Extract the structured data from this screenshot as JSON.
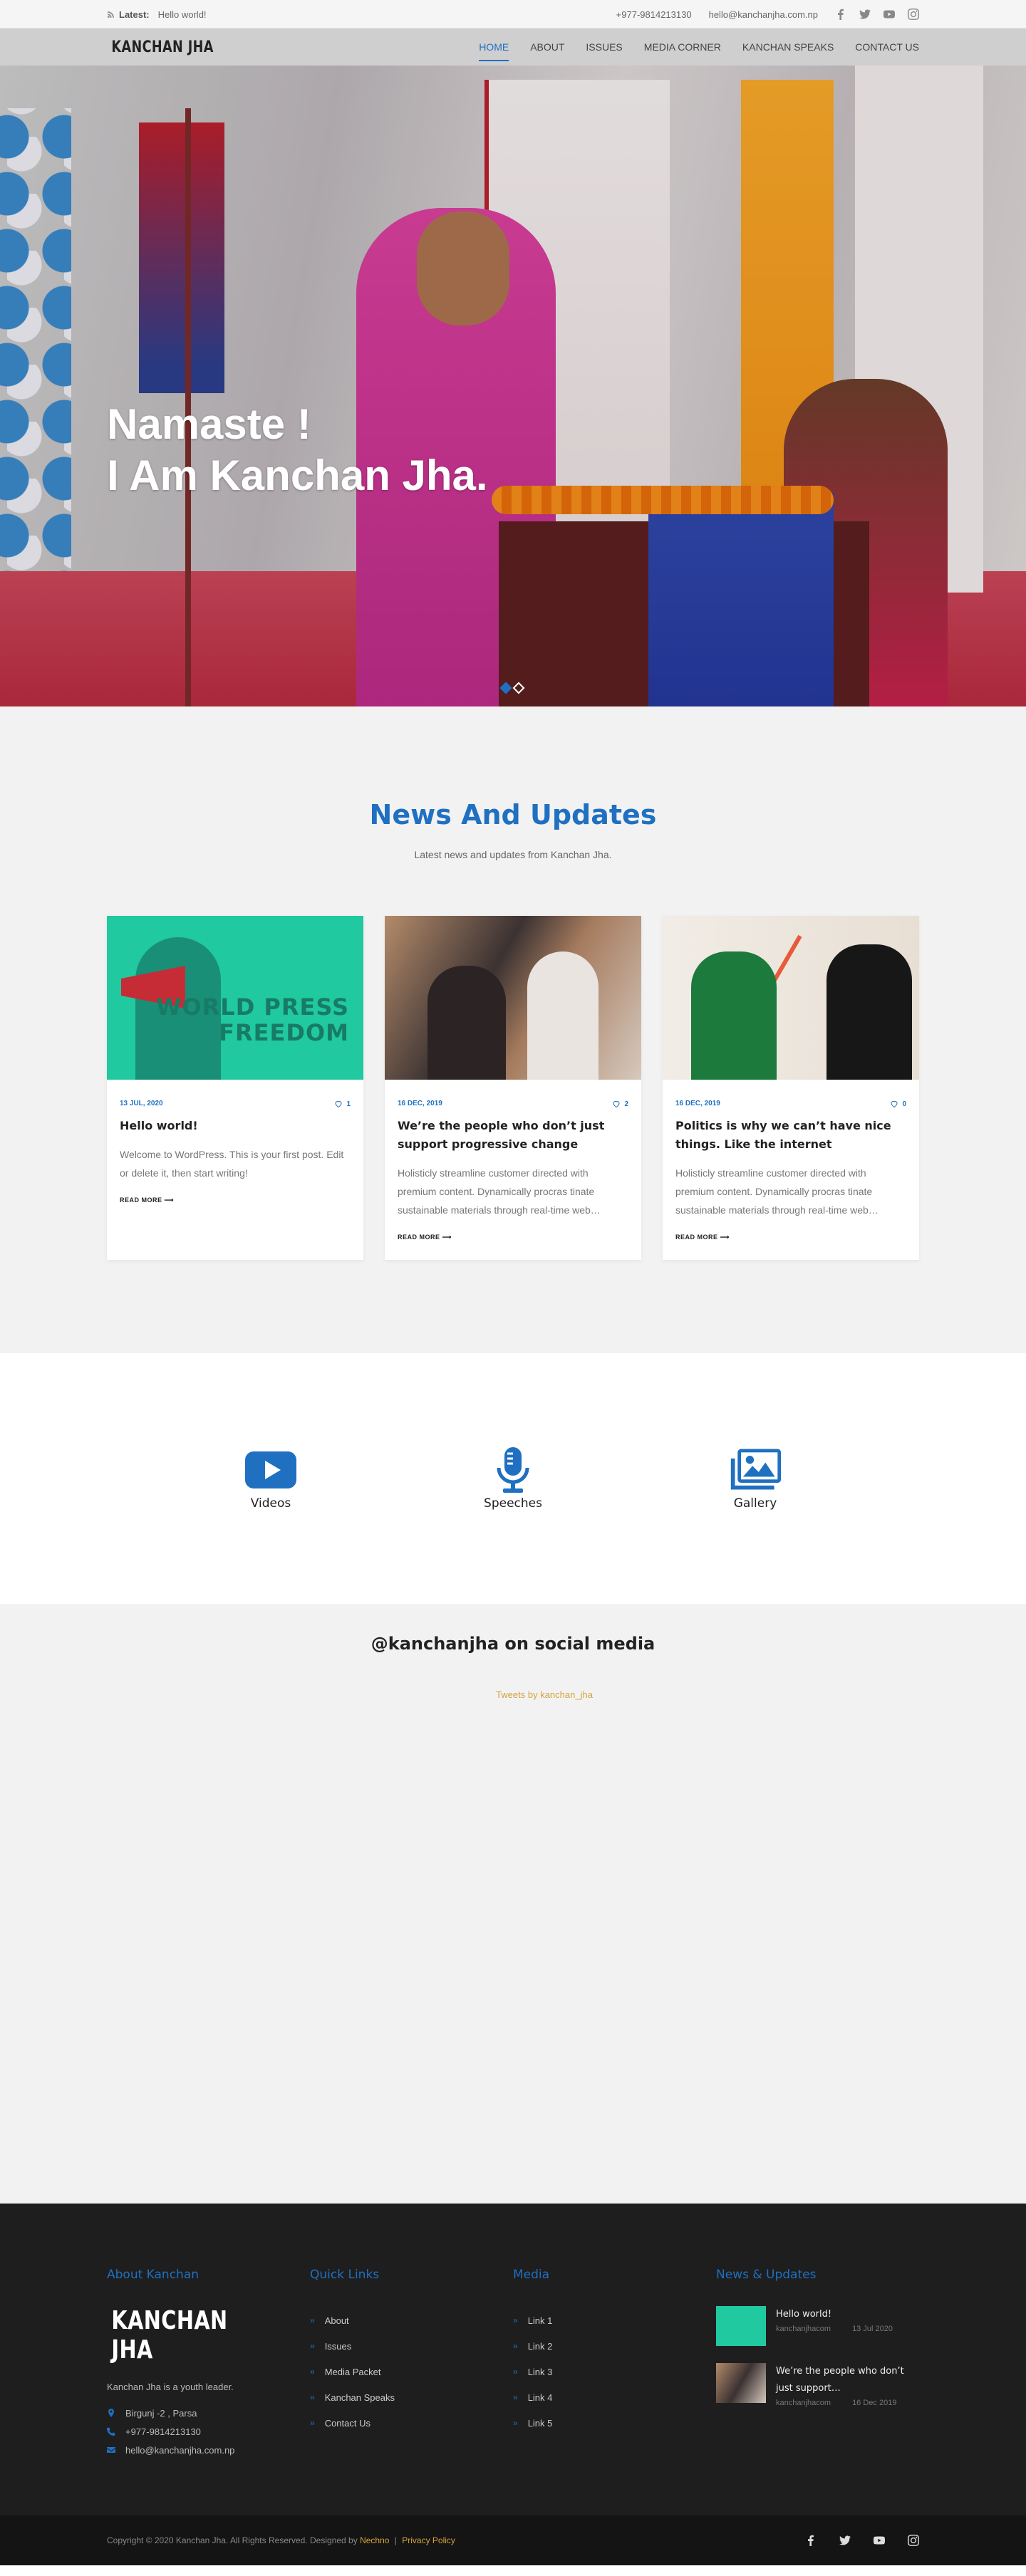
{
  "topbar": {
    "latest_label": "Latest:",
    "latest_text": "Hello world!",
    "phone": "+977-9814213130",
    "email": "hello@kanchanjha.com.np",
    "social_icons": [
      "facebook-icon",
      "twitter-icon",
      "youtube-icon",
      "instagram-icon"
    ]
  },
  "nav": {
    "logo": "KANCHAN JHA",
    "items": [
      {
        "label": "HOME",
        "active": true
      },
      {
        "label": "ABOUT"
      },
      {
        "label": "ISSUES"
      },
      {
        "label": "MEDIA CORNER"
      },
      {
        "label": "KANCHAN SPEAKS"
      },
      {
        "label": "CONTACT US"
      }
    ]
  },
  "hero": {
    "line1": "Namaste !",
    "line2": "I Am Kanchan Jha.",
    "slides": 2,
    "active_slide": 1
  },
  "news": {
    "title": "News And Updates",
    "subtitle": "Latest news and updates from Kanchan Jha.",
    "posts": [
      {
        "date": "13 JUL, 2020",
        "likes": "1",
        "title": "Hello world!",
        "excerpt": "Welcome to WordPress. This is your first post. Edit or delete it, then start writing!",
        "read_more": "READ MORE ⟶",
        "image_text": "WORLD PRESS FREEDOM"
      },
      {
        "date": "16 DEC, 2019",
        "likes": "2",
        "title": "We’re the people who don’t just support progressive change",
        "excerpt": "Holisticly streamline customer directed with premium content. Dynamically procras tinate sustainable materials through real-time web…",
        "read_more": "READ MORE ⟶"
      },
      {
        "date": "16 DEC, 2019",
        "likes": "0",
        "title": "Politics is why we can’t have nice things. Like the internet",
        "excerpt": "Holisticly streamline customer directed with premium content. Dynamically procras tinate sustainable materials through real-time web…",
        "read_more": "READ MORE ⟶"
      }
    ]
  },
  "features": [
    {
      "label": "Videos",
      "icon": "youtube-play-icon"
    },
    {
      "label": "Speeches",
      "icon": "microphone-icon"
    },
    {
      "label": "Gallery",
      "icon": "gallery-icon"
    }
  ],
  "social": {
    "title": "@kanchanjha on social media",
    "tweets_link": "Tweets by kanchan_jha"
  },
  "footer": {
    "about": {
      "title": "About Kanchan",
      "logo": "KANCHAN JHA",
      "tagline": "Kanchan Jha is a youth leader.",
      "address": "Birgunj -2 , Parsa",
      "phone": "+977-9814213130",
      "email": "hello@kanchanjha.com.np"
    },
    "quick_links": {
      "title": "Quick Links",
      "items": [
        "About",
        "Issues",
        "Media Packet",
        "Kanchan Speaks",
        "Contact Us"
      ]
    },
    "media": {
      "title": "Media",
      "items": [
        "Link 1",
        "Link 2",
        "Link 3",
        "Link 4",
        "Link 5"
      ]
    },
    "news": {
      "title": "News & Updates",
      "items": [
        {
          "title": "Hello world!",
          "author": "kanchanjhacom",
          "date": "13 Jul 2020"
        },
        {
          "title": "We’re the people who don’t just support…",
          "author": "kanchanjhacom",
          "date": "16 Dec 2019"
        }
      ]
    }
  },
  "copyright": {
    "text": "Copyright © 2020 Kanchan Jha. All Rights Reserved. Designed by",
    "designer": "Nechno",
    "separator": "|",
    "policy": "Privacy Policy"
  },
  "colors": {
    "accent": "#1f70c1",
    "link_yellow": "#d4a33a",
    "footer_bg": "#1e1e1e",
    "section_bg": "#f2f2f2"
  }
}
